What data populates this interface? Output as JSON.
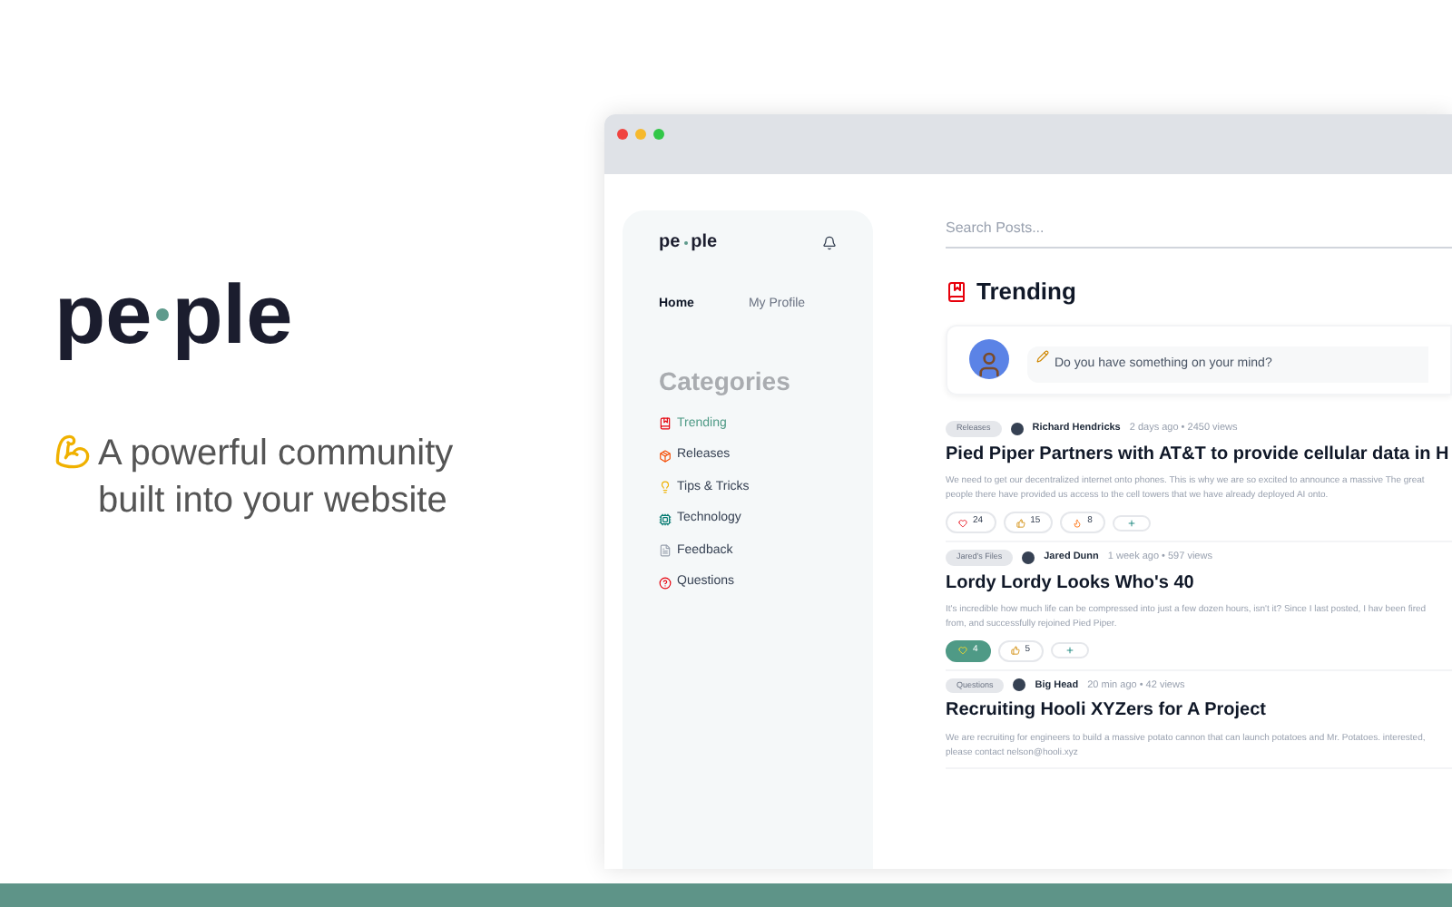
{
  "hero": {
    "logo_start": "pe",
    "logo_end": "ple",
    "tagline": "A powerful community built into your website"
  },
  "sidebar": {
    "logo_start": "pe",
    "logo_end": "ple",
    "nav": [
      {
        "label": "Home",
        "selected": true
      },
      {
        "label": "My Profile",
        "selected": false
      }
    ],
    "categories_title": "Categories",
    "categories": [
      {
        "label": "Trending",
        "selected": true
      },
      {
        "label": "Releases",
        "selected": false
      },
      {
        "label": "Tips & Tricks",
        "selected": false
      },
      {
        "label": "Technology",
        "selected": false
      },
      {
        "label": "Feedback",
        "selected": false
      },
      {
        "label": "Questions",
        "selected": false
      }
    ]
  },
  "search": {
    "placeholder": "Search Posts..."
  },
  "heading": "Trending",
  "composer": {
    "placeholder": "Do you have something on your mind?"
  },
  "posts": [
    {
      "tag": "Releases",
      "author": "Richard Hendricks",
      "meta": "2 days ago • 2450 views",
      "title": "Pied Piper Partners with AT&T to provide cellular data in H",
      "body": "We need to get our decentralized internet onto phones. This is why we are so excited to announce a massive The great people there have provided us access to the cell towers that we have already deployed AI onto.",
      "reactions": [
        {
          "count": "24",
          "selected": false
        },
        {
          "count": "15",
          "selected": false
        },
        {
          "count": "8",
          "selected": false
        }
      ]
    },
    {
      "tag": "Jared's Files",
      "author": "Jared Dunn",
      "meta": "1 week ago • 597 views",
      "title": "Lordy Lordy Looks Who's 40",
      "body": "It's incredible how much life can be compressed into just a few dozen hours, isn't it? Since I last posted, I hav been fired from, and successfully rejoined Pied Piper.",
      "reactions": [
        {
          "count": "4",
          "selected": true
        },
        {
          "count": "5",
          "selected": false
        }
      ]
    },
    {
      "tag": "Questions",
      "author": "Big Head",
      "meta": "20 min ago • 42 views",
      "title": "Recruiting Hooli XYZers for A Project",
      "body": "We are recruiting for engineers to build a massive potato cannon that can launch potatoes and Mr. Potatoes. interested, please contact nelson@hooli.xyz"
    }
  ]
}
